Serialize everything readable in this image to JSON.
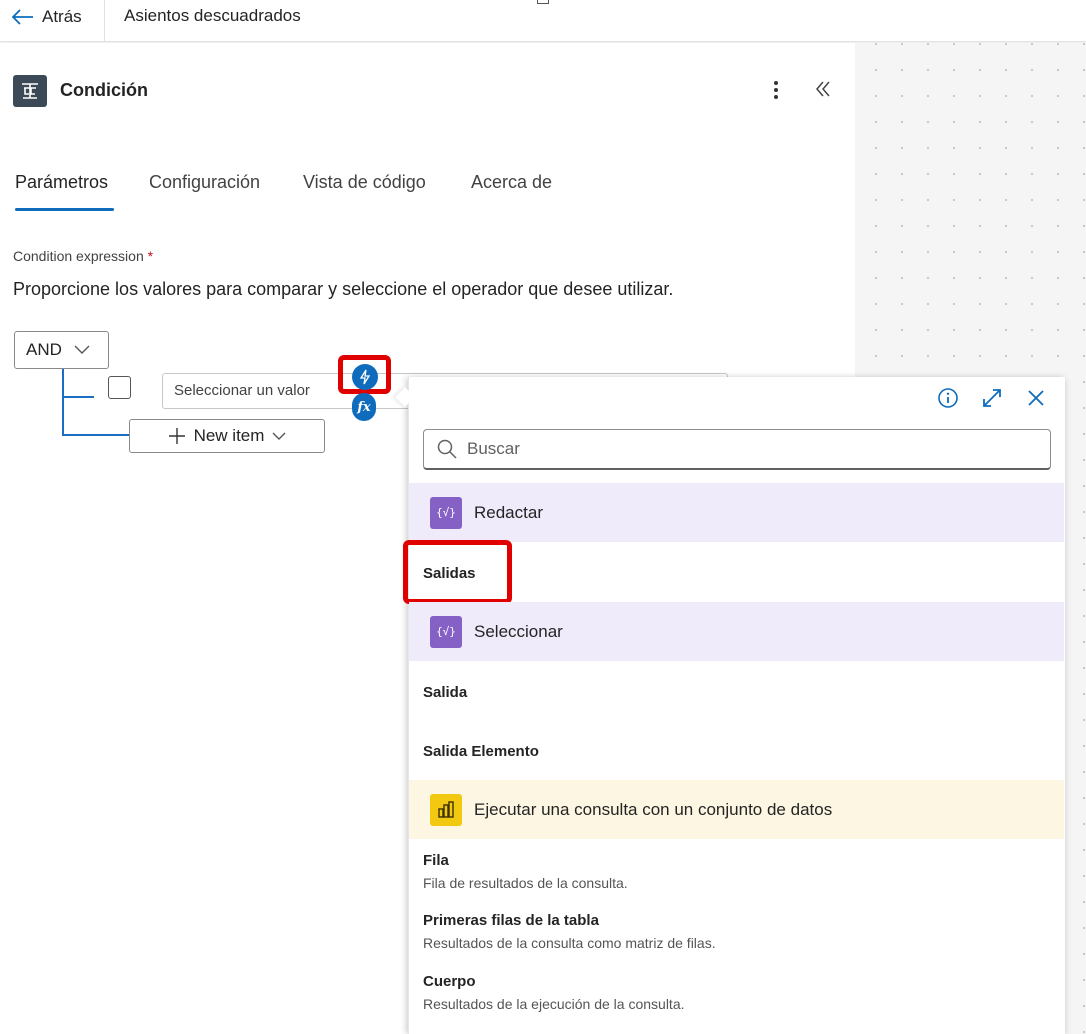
{
  "header": {
    "back_label": "Atrás",
    "flow_name": "Asientos descuadrados"
  },
  "panel": {
    "title": "Condición",
    "tabs": [
      {
        "label": "Parámetros",
        "active": true
      },
      {
        "label": "Configuración",
        "active": false
      },
      {
        "label": "Vista de código",
        "active": false
      },
      {
        "label": "Acerca de",
        "active": false
      }
    ],
    "condition_label": "Condition expression",
    "required_mark": "*",
    "description": "Proporcione los valores para comparar y seleccione el operador que desee utilizar.",
    "operator": "AND",
    "value_placeholder": "Seleccionar un valor",
    "new_item_label": "New item"
  },
  "popover": {
    "search_placeholder": "Buscar",
    "groups": [
      {
        "name": "Redactar",
        "color": "#8661c5",
        "icon": "braces-icon",
        "items": [
          {
            "label": "Salidas"
          }
        ]
      },
      {
        "name": "Seleccionar",
        "color": "#8661c5",
        "icon": "braces-icon",
        "items": [
          {
            "label": "Salida"
          },
          {
            "label": "Salida Elemento"
          }
        ]
      },
      {
        "name": "Ejecutar una consulta con un conjunto de datos",
        "color": "#f2c811",
        "icon": "powerbi-icon",
        "items": [
          {
            "label": "Fila",
            "desc": "Fila de resultados de la consulta."
          },
          {
            "label": "Primeras filas de la tabla",
            "desc": "Resultados de la consulta como matriz de filas."
          },
          {
            "label": "Cuerpo",
            "desc": "Resultados de la ejecución de la consulta."
          }
        ]
      }
    ]
  },
  "colors": {
    "accent": "#0f6cbd",
    "highlight": "#e00000"
  }
}
